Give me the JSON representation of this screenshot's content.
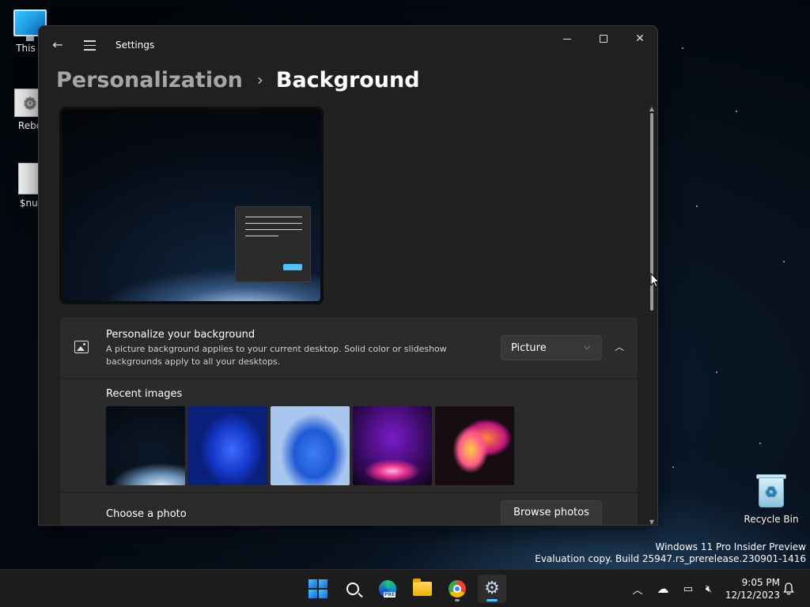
{
  "desktop": {
    "icons": [
      {
        "label": "This P"
      },
      {
        "label": "Rebo"
      },
      {
        "label": "$nul"
      },
      {
        "label": "Recycle Bin"
      }
    ],
    "watermark": {
      "line1": "Windows 11 Pro Insider Preview",
      "line2": "Evaluation copy. Build 25947.rs_prerelease.230901-1416"
    }
  },
  "window": {
    "title": "Settings",
    "breadcrumb": {
      "parent": "Personalization",
      "current": "Background"
    },
    "personalize": {
      "title": "Personalize your background",
      "description": "A picture background applies to your current desktop. Solid color or slideshow backgrounds apply to all your desktops.",
      "dropdown_value": "Picture"
    },
    "recent_images": {
      "label": "Recent images",
      "items": [
        "earth-night",
        "blue-bloom-dark",
        "blue-bloom-light",
        "purple-glow",
        "colorful-flower"
      ]
    },
    "choose_photo": {
      "label": "Choose a photo",
      "button": "Browse photos"
    }
  },
  "taskbar": {
    "apps": [
      "start",
      "search",
      "edge-pre",
      "file-explorer",
      "chrome",
      "settings"
    ],
    "clock": {
      "time": "9:05 PM",
      "date": "12/12/2023"
    }
  },
  "colors": {
    "accent": "#4cc2ff",
    "window_bg": "#202020",
    "card_bg": "#2b2b2b"
  }
}
